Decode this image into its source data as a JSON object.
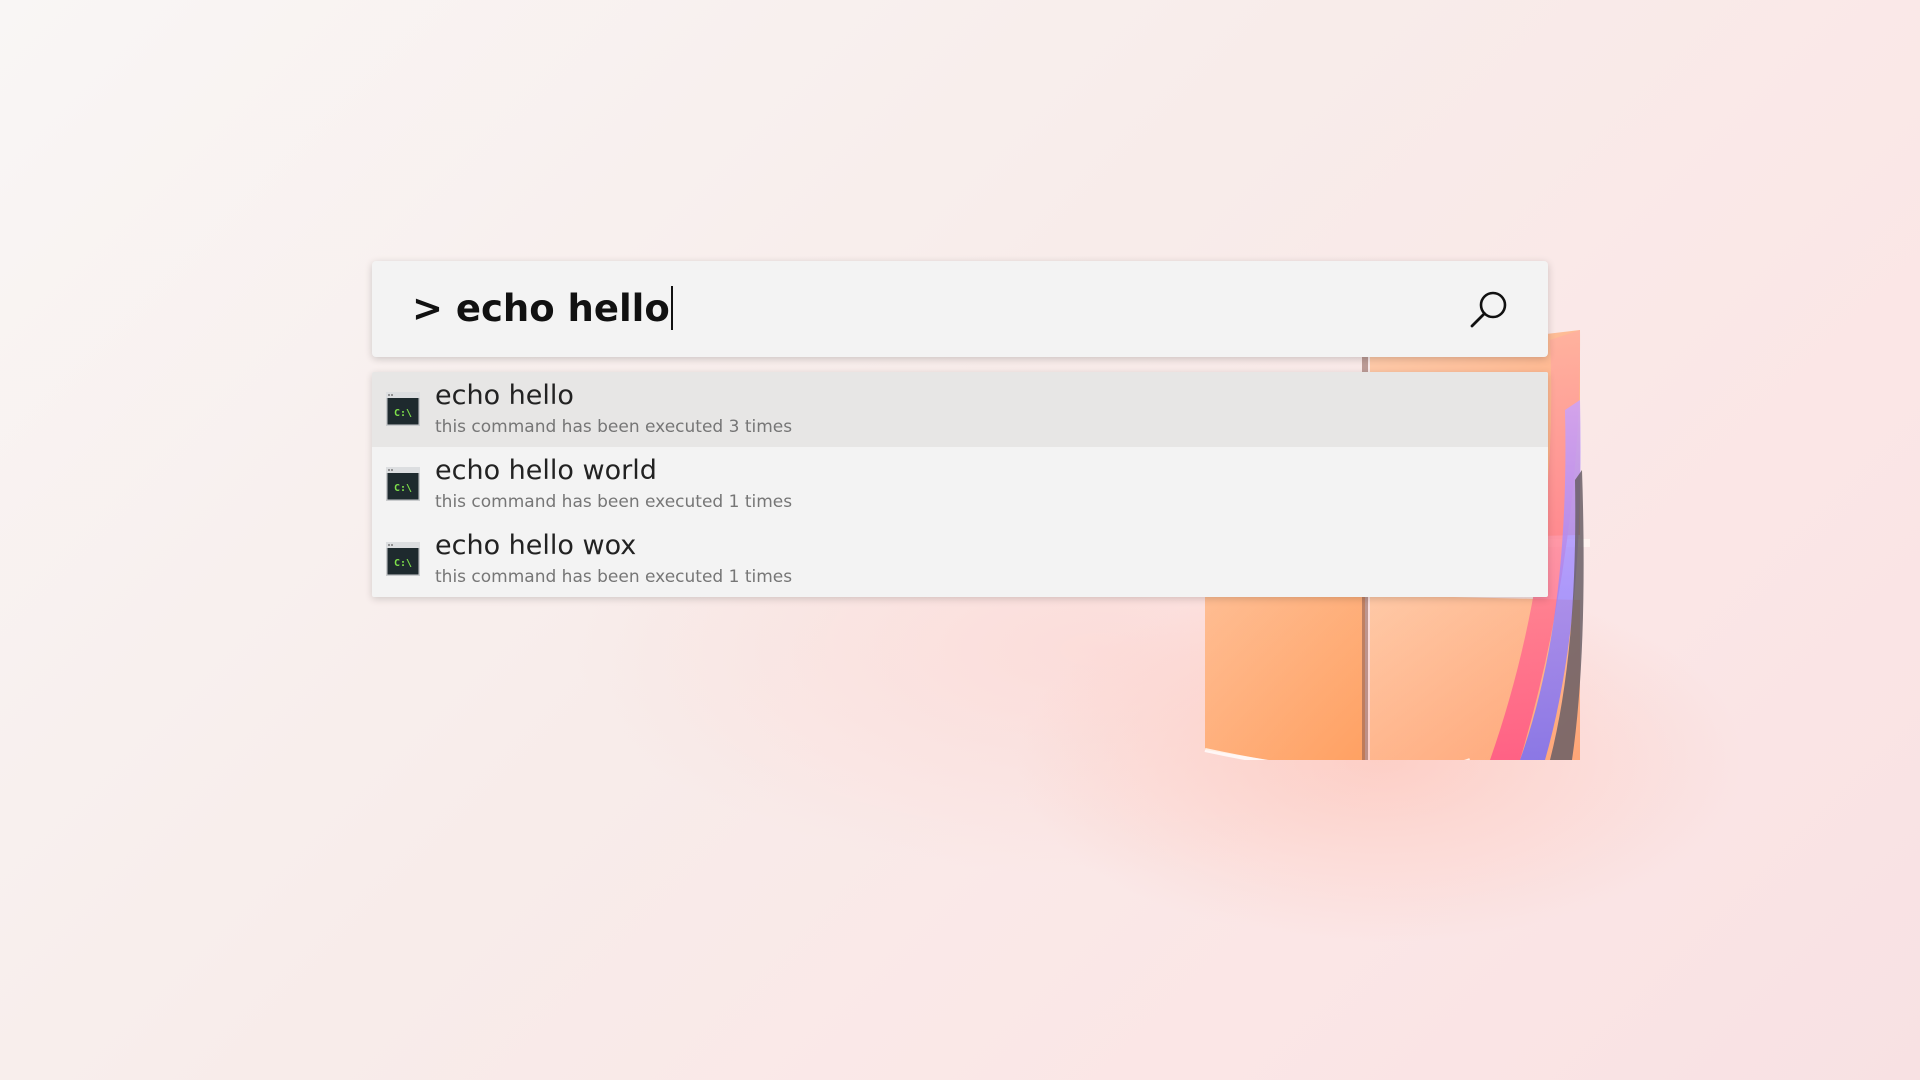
{
  "launcher": {
    "query": "> echo hello",
    "search_icon": "search-icon"
  },
  "results": [
    {
      "title": "echo hello",
      "subtitle": "this command has been executed 3 times",
      "icon": "command-prompt-icon",
      "selected": true
    },
    {
      "title": "echo hello world",
      "subtitle": "this command has been executed 1 times",
      "icon": "command-prompt-icon",
      "selected": false
    },
    {
      "title": "echo hello wox",
      "subtitle": "this command has been executed 1 times",
      "icon": "command-prompt-icon",
      "selected": false
    }
  ],
  "colors": {
    "selected_row": "#e7e6e5",
    "panel": "#f3f3f3",
    "cmd_icon_text": "#7ee04a"
  }
}
